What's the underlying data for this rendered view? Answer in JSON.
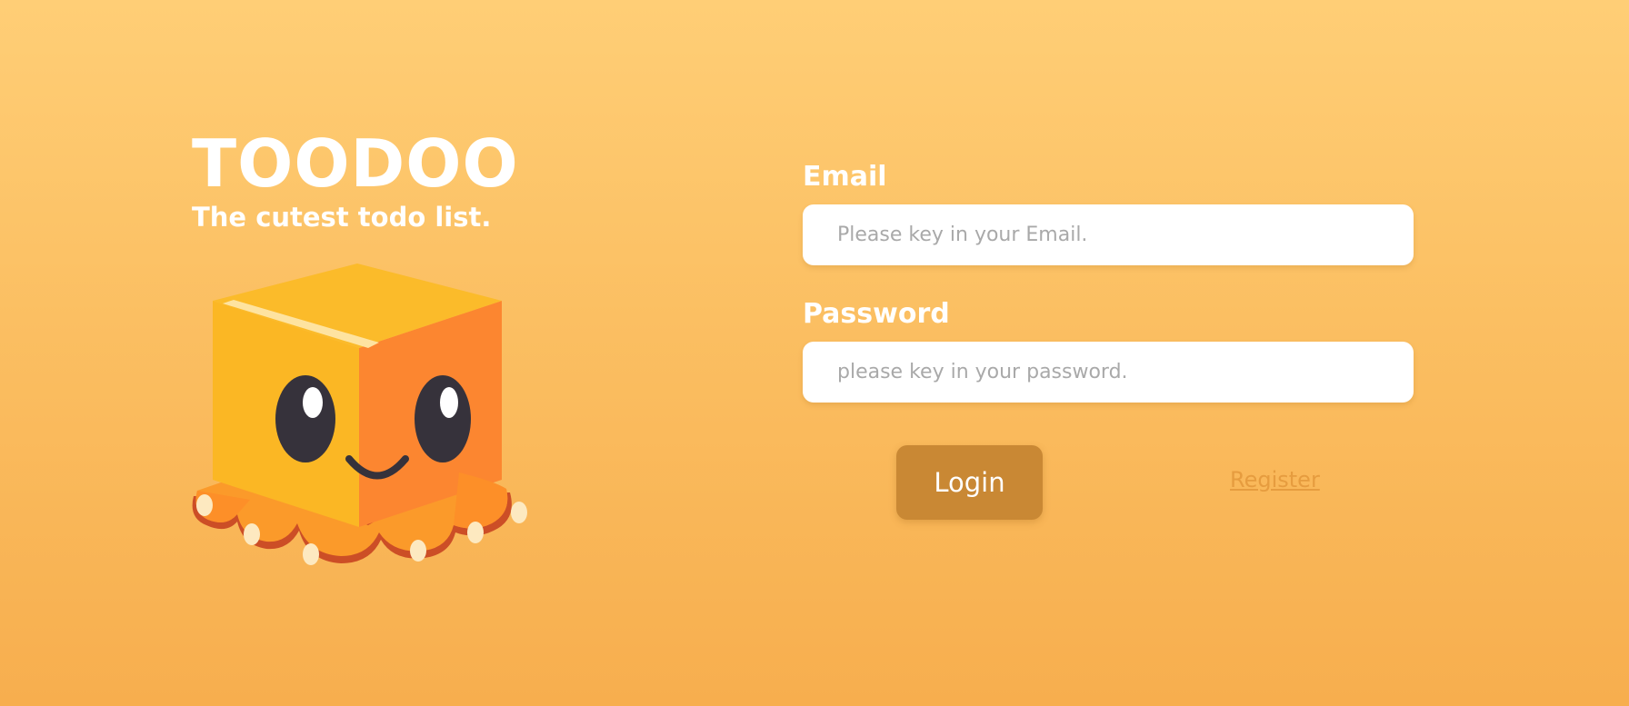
{
  "brand": {
    "title": "TOODOO",
    "tagline": "The cutest todo list."
  },
  "mascot": {
    "icon": "box-octopus-mascot-icon"
  },
  "form": {
    "email": {
      "label": "Email",
      "placeholder": "Please key in your Email.",
      "value": ""
    },
    "password": {
      "label": "Password",
      "placeholder": "please key in your password.",
      "value": ""
    },
    "login_label": "Login",
    "register_label": "Register"
  },
  "colors": {
    "background_top": "#ffce76",
    "background_bottom": "#f7ae4e",
    "login_button": "#c98834",
    "register_link": "#e69c3f",
    "mascot_yellow": "#fbb724",
    "mascot_orange": "#fc8630"
  }
}
